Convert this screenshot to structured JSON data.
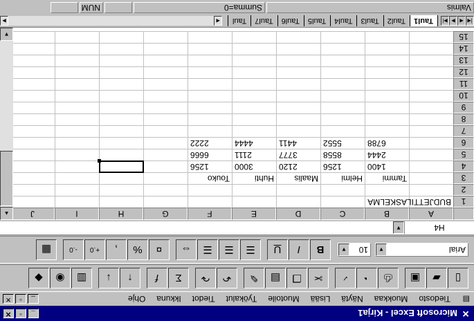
{
  "window": {
    "title": "Microsoft Excel - Kirja1"
  },
  "menu": [
    "Tiedosto",
    "Muokkaa",
    "Näytä",
    "Lisää",
    "Muotoile",
    "Työkalut",
    "Tiedot",
    "Ikkuna",
    "Ohje"
  ],
  "font": {
    "name": "Arial",
    "size": "10"
  },
  "namebox": {
    "value": "H4"
  },
  "columns": [
    "A",
    "B",
    "C",
    "D",
    "E",
    "F",
    "G",
    "H",
    "I",
    "J"
  ],
  "rows": [
    "1",
    "2",
    "3",
    "4",
    "5",
    "6",
    "7",
    "8",
    "9",
    "10",
    "11",
    "12",
    "13",
    "14",
    "15"
  ],
  "cells": {
    "A1": "BUDJETTILASKELMA",
    "B3": "Tammi",
    "C3": "Helmi",
    "D3": "Maalis",
    "E3": "Huhti",
    "F3": "Touko",
    "B4": "1400",
    "C4": "1256",
    "D4": "2120",
    "E4": "3000",
    "F4": "1256",
    "B5": "2444",
    "C5": "8558",
    "D5": "3777",
    "E5": "2111",
    "F5": "6666",
    "B6": "6788",
    "C6": "5552",
    "D6": "4411",
    "E6": "4444",
    "F6": "2222"
  },
  "sheets": [
    "Taul1",
    "Taul2",
    "Taul3",
    "Taul4",
    "Taul5",
    "Taul6",
    "Taul7",
    "Taul"
  ],
  "status": {
    "left": "Valmis",
    "sum": "Summa=0",
    "num": "NUM"
  }
}
